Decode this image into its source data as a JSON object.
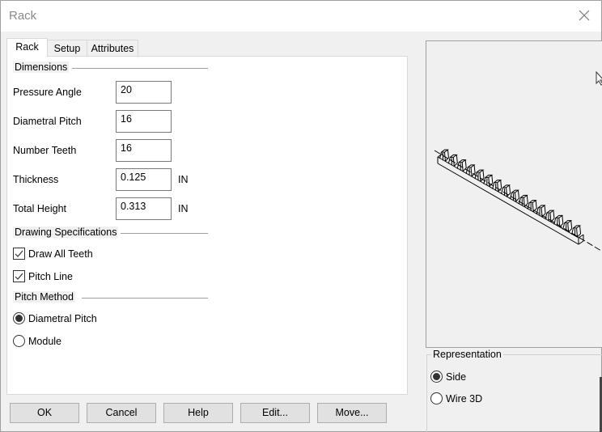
{
  "window": {
    "title": "Rack",
    "close_icon": "close-icon"
  },
  "tabs": [
    {
      "label": "Rack",
      "active": true
    },
    {
      "label": "Setup",
      "active": false
    },
    {
      "label": "Attributes",
      "active": false
    }
  ],
  "dimensions": {
    "group_label": "Dimensions",
    "fields": [
      {
        "label": "Pressure Angle",
        "value": "20",
        "unit": ""
      },
      {
        "label": "Diametral Pitch",
        "value": "16",
        "unit": ""
      },
      {
        "label": "Number Teeth",
        "value": "16",
        "unit": ""
      },
      {
        "label": "Thickness",
        "value": "0.125",
        "unit": "IN"
      },
      {
        "label": "Total Height",
        "value": "0.313",
        "unit": "IN"
      }
    ]
  },
  "drawing_specifications": {
    "group_label": "Drawing Specifications",
    "checkboxes": [
      {
        "label": "Draw All Teeth",
        "checked": true
      },
      {
        "label": "Pitch Line",
        "checked": true
      }
    ]
  },
  "pitch_method": {
    "group_label": "Pitch Method",
    "options": [
      {
        "label": "Diametral Pitch",
        "selected": true
      },
      {
        "label": "Module",
        "selected": false
      }
    ]
  },
  "buttons": {
    "ok": "OK",
    "cancel": "Cancel",
    "help": "Help",
    "edit": "Edit...",
    "move": "Move..."
  },
  "preview": {
    "description": "isometric wireframe rack gear",
    "teeth_count": 16
  },
  "representation": {
    "group_label": "Representation",
    "options": [
      {
        "label": "Side",
        "selected": true
      },
      {
        "label": "Wire 3D",
        "selected": false
      }
    ]
  }
}
